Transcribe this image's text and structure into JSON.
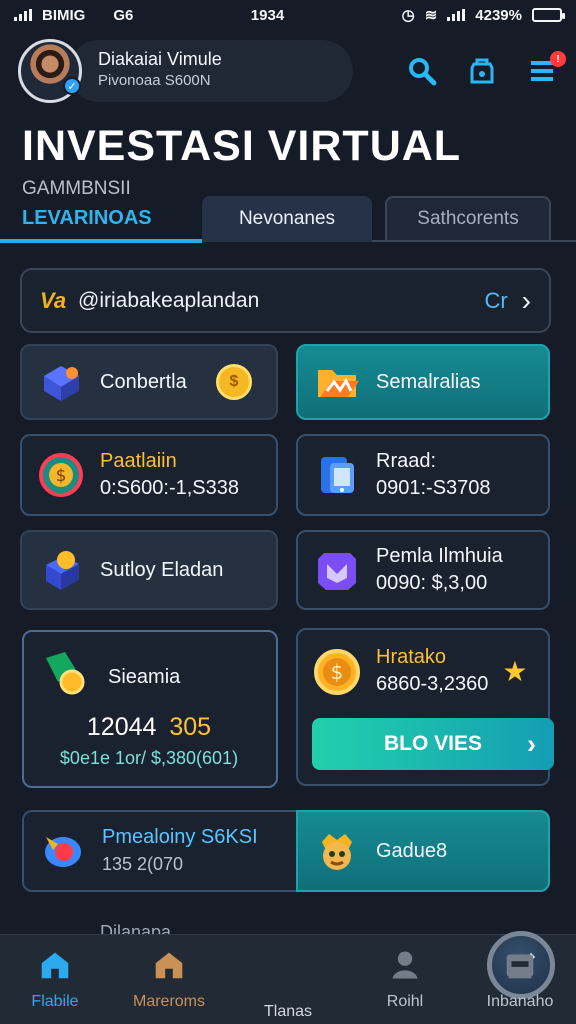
{
  "status": {
    "left_text": "BIMIG",
    "network": "G6",
    "time": "1934",
    "battery": "4239%"
  },
  "profile": {
    "name": "Diakaiai Vimule",
    "subtitle": "Pivonoaa S600N"
  },
  "page": {
    "title": "INVESTASI VIRTUAL",
    "subtitle": "GAMMBNSII",
    "section": "LEVARINOAS",
    "tabs": [
      "Nevonanes",
      "Sathcorents"
    ]
  },
  "search": {
    "prefix": "Va",
    "text": "@iriabakeaplandan",
    "right_label": "Cr"
  },
  "cards": [
    {
      "label": "Conbertla"
    },
    {
      "label": "Semalralias"
    },
    {
      "label": "Paatlaiin",
      "value": "0:S600:-1,S338"
    },
    {
      "label": "Rraad:",
      "value": "0901:-S3708"
    },
    {
      "label": "Sutloy Eladan"
    },
    {
      "label": "Pemla Ilmhuia",
      "value": "0090: $,3,00"
    },
    {
      "label": "Sieamia",
      "value": "12044",
      "value_accent": "305",
      "note": "$0e1e 1or/ $,380(601)"
    },
    {
      "label": "Hratako",
      "value": "6860-3,2360"
    },
    {
      "label": "Pmealoiny S6KSI",
      "value": "135 2(070"
    },
    {
      "label": "Gadue8"
    },
    {
      "label": "Dilanapa"
    }
  ],
  "buttons": {
    "action": "BLO VIES"
  },
  "nav": [
    {
      "label": "Flabile"
    },
    {
      "label": "Mareroms"
    },
    {
      "label": "Tlanas"
    },
    {
      "label": "Roihl"
    },
    {
      "label": "Inbanaho"
    }
  ],
  "colors": {
    "background": "#151b27",
    "accent": "#2bb7f3",
    "teal": "#168b93",
    "gold": "#ffbf35"
  }
}
